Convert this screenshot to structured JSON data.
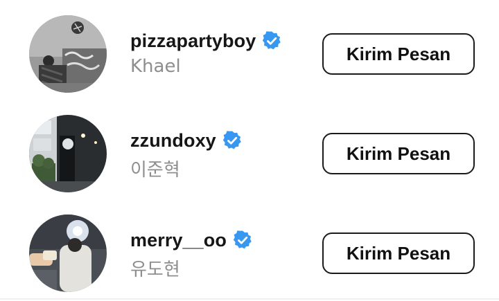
{
  "accent": {
    "verified_blue": "#3897f0",
    "text_primary": "#161616",
    "text_secondary": "#8e8e8e"
  },
  "users": [
    {
      "username": "pizzapartyboy",
      "full_name": "Khael",
      "verified": true,
      "avatar_icon": "avatar-photo-icon",
      "button_label": "Kirim Pesan"
    },
    {
      "username": "zzundoxy",
      "full_name": "이준혁",
      "verified": true,
      "avatar_icon": "avatar-photo-icon",
      "button_label": "Kirim Pesan"
    },
    {
      "username": "merry__oo",
      "full_name": "유도현",
      "verified": true,
      "avatar_icon": "avatar-photo-icon",
      "button_label": "Kirim Pesan"
    }
  ]
}
